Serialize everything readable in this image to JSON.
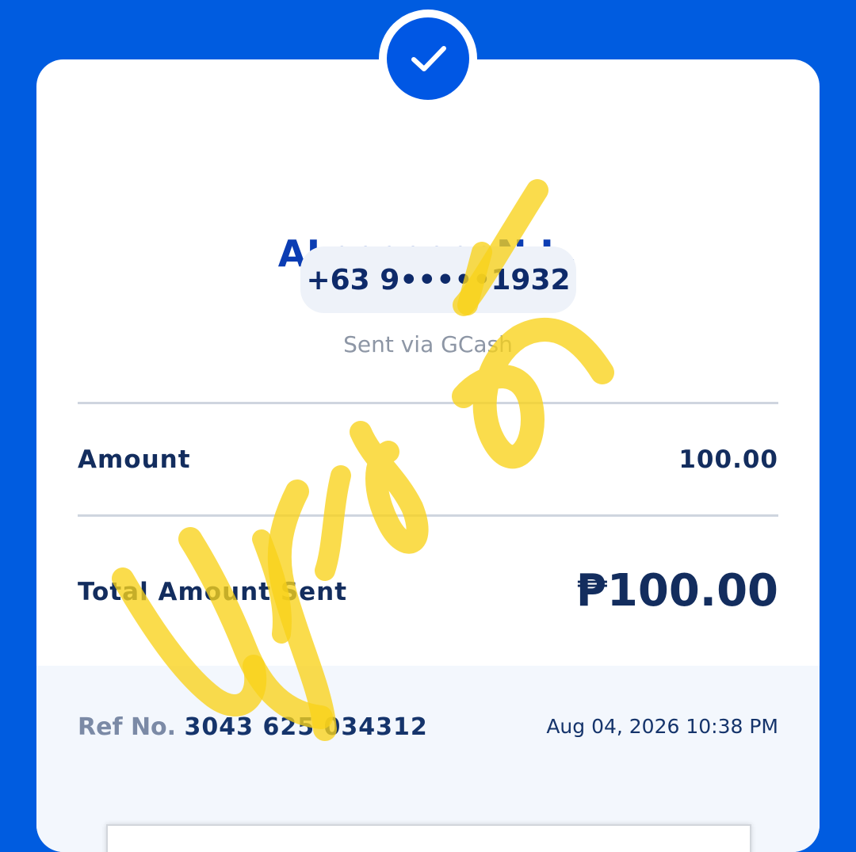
{
  "recipient": {
    "name": "AL•••••••N L.",
    "phone": "+63 9•••••1932",
    "sent_via": "Sent via GCash"
  },
  "amount": {
    "label": "Amount",
    "value": "100.00"
  },
  "total": {
    "label": "Total Amount Sent",
    "value": "₱100.00"
  },
  "reference": {
    "label": "Ref No.",
    "number": "3043 625 034312",
    "datetime": "Aug 04, 2026 10:38 PM"
  },
  "icons": {
    "status": "checkmark-icon"
  },
  "colors": {
    "background": "#005ce0",
    "accent": "#0057e4",
    "text_dark": "#132d5e",
    "signature": "#f9d21a"
  }
}
